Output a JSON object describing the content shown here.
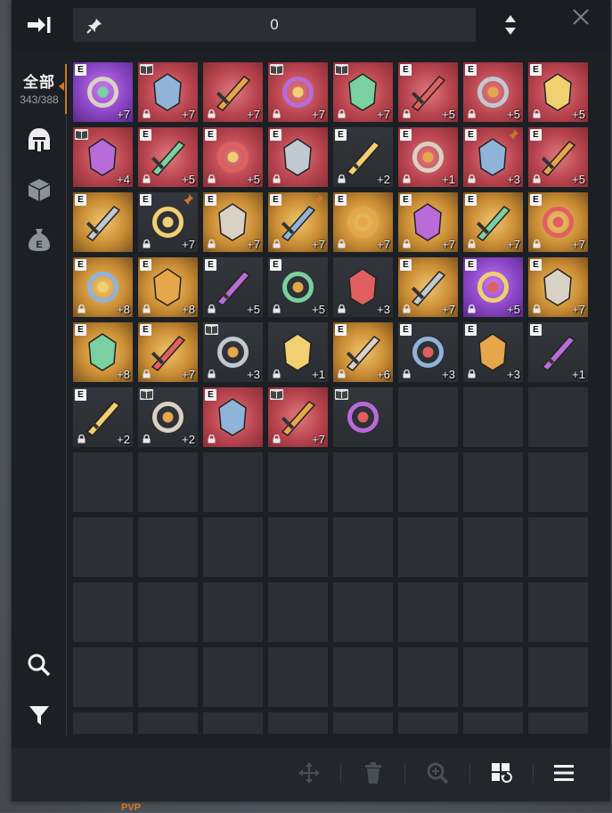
{
  "header": {
    "pin_count": "0",
    "collapse_icon": "collapse-right-icon",
    "sort_icon": "sort-updown-icon",
    "close_icon": "close-icon"
  },
  "sidebar": {
    "all_label": "全部",
    "capacity": "343/388",
    "tabs": [
      "equipment-helmet-icon",
      "box-icon",
      "money-bag-icon"
    ],
    "search_icon": "search-icon",
    "filter_icon": "filter-icon"
  },
  "footer_text": "PVP",
  "colors": {
    "accent": "#c9772c",
    "bg_red": "#c24a55",
    "bg_purple": "#7a3fb8",
    "bg_gold": "#c48d32",
    "bg_dark": "#2e3137"
  },
  "inventory": {
    "rows": [
      [
        {
          "b": "E",
          "lvl": "+7",
          "bg": "purple",
          "lock": false,
          "pin": false
        },
        {
          "b": "book",
          "lvl": "+7",
          "bg": "red",
          "lock": true,
          "pin": false
        },
        {
          "b": "",
          "lvl": "+7",
          "bg": "red",
          "lock": true,
          "pin": false
        },
        {
          "b": "book",
          "lvl": "+7",
          "bg": "red",
          "lock": true,
          "pin": false
        },
        {
          "b": "book",
          "lvl": "+7",
          "bg": "red",
          "lock": true,
          "pin": false
        },
        {
          "b": "E",
          "lvl": "+5",
          "bg": "red",
          "lock": true,
          "pin": false
        },
        {
          "b": "E",
          "lvl": "+5",
          "bg": "red",
          "lock": true,
          "pin": false
        },
        {
          "b": "E",
          "lvl": "+5",
          "bg": "red",
          "lock": true,
          "pin": false
        }
      ],
      [
        {
          "b": "book",
          "lvl": "+4",
          "bg": "red",
          "lock": false,
          "pin": false
        },
        {
          "b": "E",
          "lvl": "+5",
          "bg": "red",
          "lock": true,
          "pin": false
        },
        {
          "b": "E",
          "lvl": "+5",
          "bg": "red",
          "lock": true,
          "pin": false
        },
        {
          "b": "E",
          "lvl": "",
          "bg": "red",
          "lock": true,
          "pin": false
        },
        {
          "b": "E",
          "lvl": "+2",
          "bg": "dark",
          "lock": true,
          "pin": false
        },
        {
          "b": "E",
          "lvl": "+1",
          "bg": "red",
          "lock": true,
          "pin": false
        },
        {
          "b": "E",
          "lvl": "+3",
          "bg": "red",
          "lock": true,
          "pin": true
        },
        {
          "b": "E",
          "lvl": "+5",
          "bg": "red",
          "lock": true,
          "pin": false
        }
      ],
      [
        {
          "b": "E",
          "lvl": "",
          "bg": "gold",
          "lock": false,
          "pin": false
        },
        {
          "b": "E",
          "lvl": "+7",
          "bg": "dark",
          "lock": true,
          "pin": true
        },
        {
          "b": "E",
          "lvl": "+7",
          "bg": "gold",
          "lock": true,
          "pin": false
        },
        {
          "b": "E",
          "lvl": "+7",
          "bg": "gold",
          "lock": true,
          "pin": true
        },
        {
          "b": "E",
          "lvl": "+7",
          "bg": "gold",
          "lock": true,
          "pin": false
        },
        {
          "b": "E",
          "lvl": "+7",
          "bg": "gold",
          "lock": true,
          "pin": false
        },
        {
          "b": "E",
          "lvl": "+7",
          "bg": "gold",
          "lock": true,
          "pin": false
        },
        {
          "b": "E",
          "lvl": "+7",
          "bg": "gold",
          "lock": true,
          "pin": false
        }
      ],
      [
        {
          "b": "E",
          "lvl": "+8",
          "bg": "gold",
          "lock": true,
          "pin": false
        },
        {
          "b": "E",
          "lvl": "+8",
          "bg": "gold",
          "lock": true,
          "pin": false
        },
        {
          "b": "E",
          "lvl": "+5",
          "bg": "dark",
          "lock": true,
          "pin": false
        },
        {
          "b": "E",
          "lvl": "+5",
          "bg": "dark",
          "lock": true,
          "pin": false
        },
        {
          "b": "",
          "lvl": "+3",
          "bg": "dark",
          "lock": true,
          "pin": false
        },
        {
          "b": "E",
          "lvl": "+7",
          "bg": "gold",
          "lock": true,
          "pin": false
        },
        {
          "b": "E",
          "lvl": "+5",
          "bg": "purple",
          "lock": true,
          "pin": false
        },
        {
          "b": "E",
          "lvl": "+7",
          "bg": "gold",
          "lock": true,
          "pin": false
        }
      ],
      [
        {
          "b": "E",
          "lvl": "+8",
          "bg": "gold",
          "lock": false,
          "pin": false
        },
        {
          "b": "E",
          "lvl": "+7",
          "bg": "gold",
          "lock": true,
          "pin": false
        },
        {
          "b": "book",
          "lvl": "+3",
          "bg": "dark",
          "lock": true,
          "pin": false
        },
        {
          "b": "",
          "lvl": "+1",
          "bg": "dark",
          "lock": true,
          "pin": false
        },
        {
          "b": "E",
          "lvl": "+6",
          "bg": "gold",
          "lock": true,
          "pin": false
        },
        {
          "b": "E",
          "lvl": "+3",
          "bg": "dark",
          "lock": true,
          "pin": false
        },
        {
          "b": "E",
          "lvl": "+3",
          "bg": "dark",
          "lock": true,
          "pin": false
        },
        {
          "b": "E",
          "lvl": "+1",
          "bg": "dark",
          "lock": false,
          "pin": false
        }
      ],
      [
        {
          "b": "E",
          "lvl": "+2",
          "bg": "dark",
          "lock": true,
          "pin": false
        },
        {
          "b": "book",
          "lvl": "+2",
          "bg": "dark",
          "lock": true,
          "pin": false
        },
        {
          "b": "E",
          "lvl": "",
          "bg": "red",
          "lock": true,
          "pin": false
        },
        {
          "b": "book",
          "lvl": "+7",
          "bg": "red",
          "lock": true,
          "pin": false
        },
        {
          "b": "book",
          "lvl": "",
          "bg": "dark",
          "lock": false,
          "pin": false
        }
      ]
    ],
    "empty_rows": 5
  },
  "toolbar": [
    "move-icon",
    "trash-icon",
    "zoom-in-icon",
    "grid-sort-icon",
    "menu-icon"
  ]
}
